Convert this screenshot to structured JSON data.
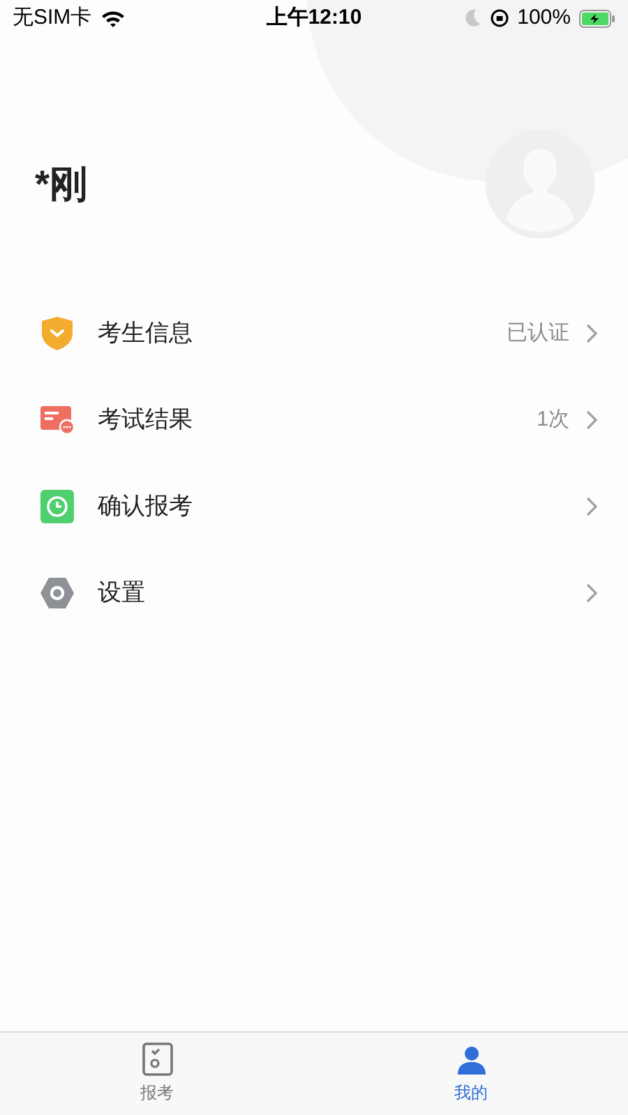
{
  "status_bar": {
    "carrier": "无SIM卡",
    "time": "上午12:10",
    "battery": "100%"
  },
  "profile": {
    "name": "*刚"
  },
  "menu": [
    {
      "kind": "shield",
      "label": "考生信息",
      "value": "已认证"
    },
    {
      "kind": "card",
      "label": "考试结果",
      "value": "1次"
    },
    {
      "kind": "clock",
      "label": "确认报考"
    },
    {
      "kind": "gear",
      "label": "设置"
    }
  ],
  "tabs": [
    {
      "kind": "exam",
      "label": "报考",
      "selected": false
    },
    {
      "kind": "me",
      "label": "我的",
      "selected": true
    }
  ]
}
